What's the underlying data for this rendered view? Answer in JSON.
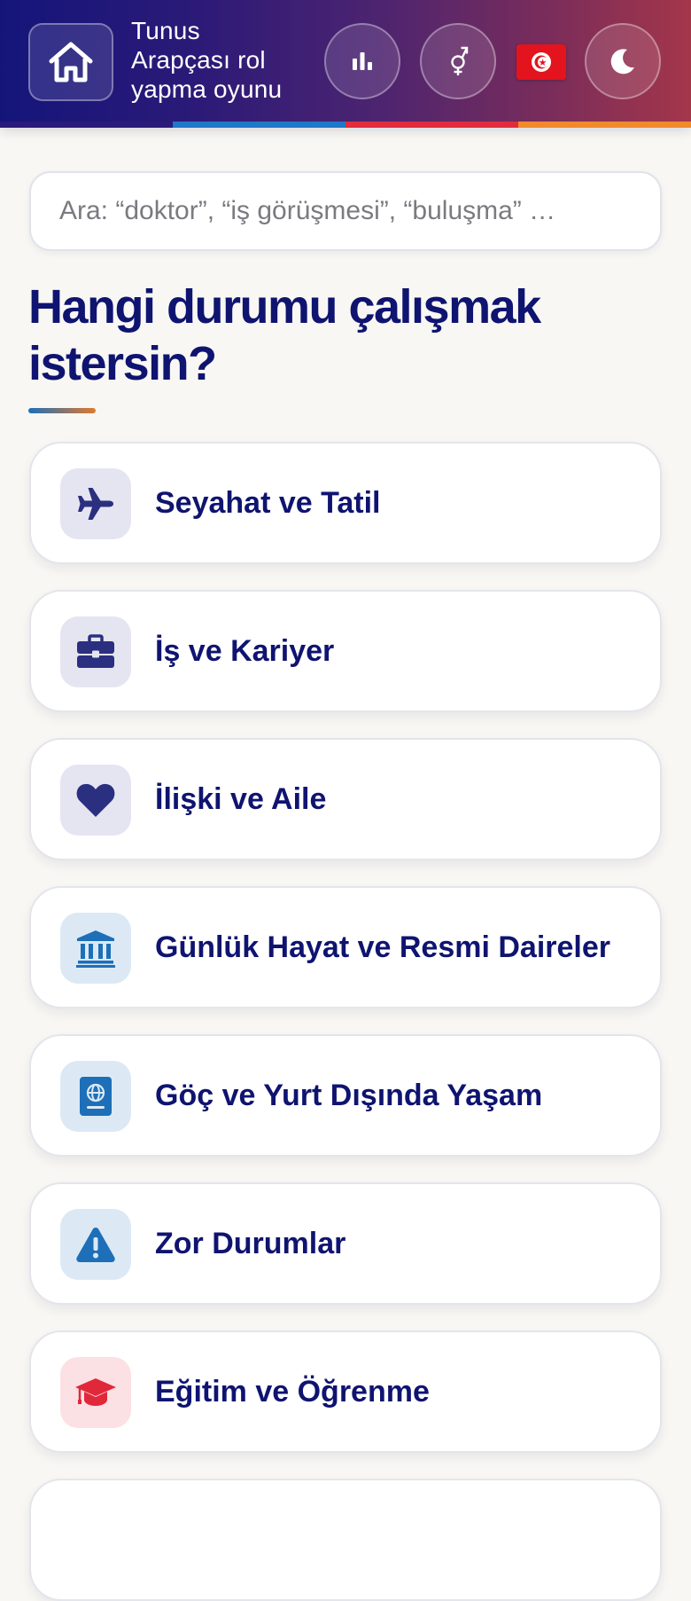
{
  "header": {
    "title_lines": [
      "Tunus",
      "Arapçası rol",
      "yapma oyunu"
    ],
    "stripe_colors": [
      "#2a1a7a",
      "#1f78c8",
      "#e02c3c",
      "#f08a2c"
    ]
  },
  "icons": {
    "home": "home-icon",
    "stats": "bar-chart-icon",
    "gender": "gender-icon",
    "flag": "tunisia-flag-icon",
    "theme": "moon-icon"
  },
  "search": {
    "placeholder": "Ara: “doktor”, “iş görüşmesi”, “buluşma” …"
  },
  "heading": {
    "text": "Hangi durumu çalışmak istersin?"
  },
  "categories": [
    {
      "label": "Seyahat ve Tatil",
      "icon": "airplane-icon",
      "accent": "#2b2f80"
    },
    {
      "label": "İş ve Kariyer",
      "icon": "briefcase-icon",
      "accent": "#2b2f80"
    },
    {
      "label": "İlişki ve Aile",
      "icon": "heart-icon",
      "accent": "#2b2f80"
    },
    {
      "label": "Günlük Hayat ve Resmi Daireler",
      "icon": "bank-icon",
      "accent": "#1d6fb8"
    },
    {
      "label": "Göç ve Yurt Dışında Yaşam",
      "icon": "passport-icon",
      "accent": "#1d6fb8"
    },
    {
      "label": "Zor Durumlar",
      "icon": "warning-icon",
      "accent": "#1d6fb8"
    },
    {
      "label": "Eğitim ve Öğrenme",
      "icon": "graduation-cap-icon",
      "accent": "#e0283a"
    }
  ]
}
